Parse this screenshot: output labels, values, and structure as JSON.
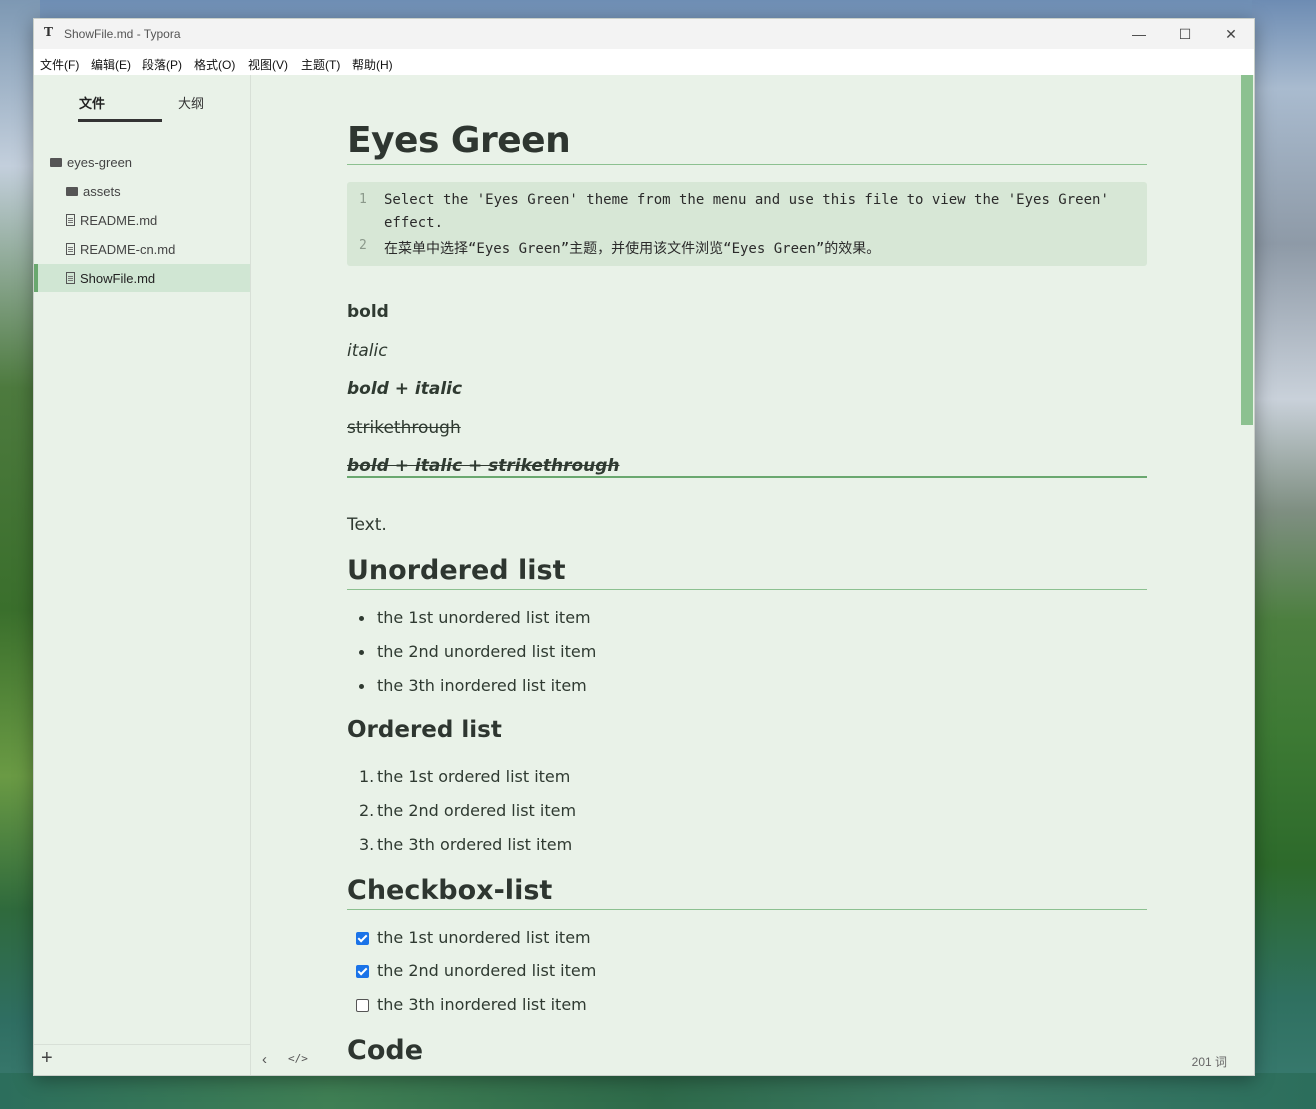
{
  "window": {
    "app_icon": "T",
    "title": "ShowFile.md - Typora",
    "controls": {
      "minimize": "—",
      "maximize": "☐",
      "close": "✕"
    }
  },
  "menu": [
    "文件(F)",
    "编辑(E)",
    "段落(P)",
    "格式(O)",
    "视图(V)",
    "主题(T)",
    "帮助(H)"
  ],
  "sidebar": {
    "tabs": {
      "files": "文件",
      "outline": "大纲"
    },
    "tree": {
      "root": "eyes-green",
      "items": [
        {
          "label": "assets",
          "type": "folder"
        },
        {
          "label": "README.md",
          "type": "file"
        },
        {
          "label": "README-cn.md",
          "type": "file"
        },
        {
          "label": "ShowFile.md",
          "type": "file",
          "active": true
        }
      ]
    },
    "add_button": "+"
  },
  "doc": {
    "title": "Eyes Green",
    "code": {
      "lines": [
        {
          "n": "1",
          "text": "Select the 'Eyes Green' theme from the menu and use this file to view the 'Eyes Green'"
        },
        {
          "n": "",
          "text": "effect."
        },
        {
          "n": "2",
          "text": "在菜单中选择“Eyes Green”主题，并使用该文件浏览“Eyes Green”的效果。"
        }
      ]
    },
    "bold": "bold",
    "italic": "italic",
    "bold_italic": "bold + italic",
    "strike": "strikethrough",
    "bold_italic_strike": "bold + italic + strikethrough",
    "text": "Text.",
    "unordered": {
      "heading": "Unordered list",
      "items": [
        "the 1st unordered list item",
        "the 2nd unordered list item",
        "the 3th inordered list item"
      ]
    },
    "ordered": {
      "heading": "Ordered list",
      "numbers": [
        "1.",
        "2.",
        "3."
      ],
      "items": [
        "the 1st ordered list item",
        "the 2nd ordered list item",
        "the 3th ordered list item"
      ]
    },
    "checkbox": {
      "heading": "Checkbox-list",
      "items": [
        {
          "label": "the 1st unordered list item",
          "checked": true
        },
        {
          "label": "the 2nd unordered list item",
          "checked": true
        },
        {
          "label": "the 3th inordered list item",
          "checked": false
        }
      ]
    },
    "code_heading": "Code"
  },
  "footer": {
    "back_icon": "‹",
    "source_icon": "</>",
    "word_count": "201 词"
  },
  "colors": {
    "accent": "#6aa86f",
    "background": "#e9f2e8",
    "active_row": "#d0e6d3",
    "code_bg": "#d7e7d6",
    "checkbox": "#1a73e8"
  }
}
